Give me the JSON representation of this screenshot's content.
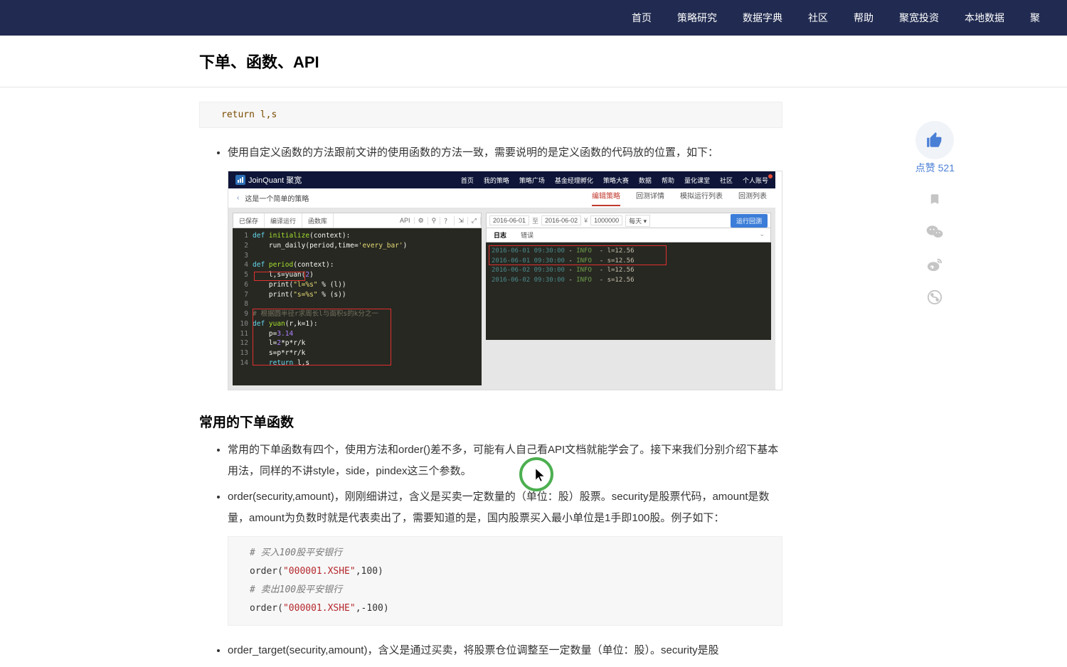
{
  "nav": {
    "items": [
      "首页",
      "策略研究",
      "数据字典",
      "社区",
      "帮助",
      "聚宽投资",
      "本地数据",
      "聚"
    ]
  },
  "header": {
    "title": "下单、函数、API"
  },
  "code_top": {
    "line": "    return l,s"
  },
  "bullet1": "使用自定义函数的方法跟前文讲的使用函数的方法一致，需要说明的是定义函数的代码放的位置，如下：",
  "mini": {
    "logo": "JoinQuant 聚宽",
    "nav": [
      "首页",
      "我的策略",
      "策略广场",
      "基金经理孵化",
      "策略大赛",
      "数据",
      "帮助",
      "量化课堂",
      "社区",
      "个人账号"
    ],
    "back": "‹",
    "strategy_name": "这是一个简单的策略",
    "rtabs": [
      "编辑策略",
      "回测详情",
      "模拟运行列表",
      "回测列表"
    ],
    "toolbar_left": [
      "已保存",
      "编译运行",
      "函数库"
    ],
    "toolbar_right": [
      "API",
      "⚙",
      "⚲",
      "？",
      "⇲",
      "⤢"
    ],
    "editor_lines": [
      {
        "n": "1",
        "prefix": "",
        "kw": "def ",
        "fn": "initialize",
        "rest": "(context):"
      },
      {
        "n": "2",
        "prefix": "    ",
        "text_pre": "run_daily(period,time=",
        "str": "'every_bar'",
        "text_post": ")"
      },
      {
        "n": "3",
        "prefix": "",
        "text_pre": "",
        "text_post": ""
      },
      {
        "n": "4",
        "prefix": "",
        "kw": "def ",
        "fn": "period",
        "rest": "(context):"
      },
      {
        "n": "5",
        "prefix": "    ",
        "text_pre": "l,s=yuan(",
        "num": "2",
        "text_post": ")"
      },
      {
        "n": "6",
        "prefix": "    ",
        "text_pre": "print(",
        "str": "\"l=%s\"",
        "text_post": " % (l))"
      },
      {
        "n": "7",
        "prefix": "    ",
        "text_pre": "print(",
        "str": "\"s=%s\"",
        "text_post": " % (s))"
      },
      {
        "n": "8",
        "prefix": "",
        "text_pre": "",
        "text_post": ""
      },
      {
        "n": "9",
        "prefix": "",
        "com": "# 根据圆半径r求周长l与面积s的k分之一"
      },
      {
        "n": "10",
        "prefix": "",
        "kw": "def ",
        "fn": "yuan",
        "rest": "(r,k=1):"
      },
      {
        "n": "11",
        "prefix": "    ",
        "text_pre": "p=",
        "num": "3.14",
        "text_post": ""
      },
      {
        "n": "12",
        "prefix": "    ",
        "text_pre": "l=",
        "num": "2",
        "text_post": "*p*r/k"
      },
      {
        "n": "13",
        "prefix": "    ",
        "text_pre": "s=p*r*r/k",
        "text_post": ""
      },
      {
        "n": "14",
        "prefix": "    ",
        "kw": "return ",
        "text_pre": "l,s",
        "text_post": ""
      }
    ],
    "run": {
      "date_from": "2016-06-01",
      "to": "至",
      "date_to": "2016-06-02",
      "currency": "¥",
      "amount": "1000000",
      "freq": "每天 ▾",
      "btn": "运行回测"
    },
    "log_tabs": [
      "日志",
      "错误"
    ],
    "logs": [
      {
        "ts": "2016-06-01 09:30:00",
        "lvl": "INFO",
        "msg": "l=12.56"
      },
      {
        "ts": "2016-06-01 09:30:00",
        "lvl": "INFO",
        "msg": "s=12.56"
      },
      {
        "ts": "2016-06-02 09:30:00",
        "lvl": "INFO",
        "msg": "l=12.56"
      },
      {
        "ts": "2016-06-02 09:30:00",
        "lvl": "INFO",
        "msg": "s=12.56"
      }
    ]
  },
  "section2": {
    "title": "常用的下单函数"
  },
  "bullets2": [
    "常用的下单函数有四个，使用方法和order()差不多，可能有人自己看API文档就能学会了。接下来我们分别介绍下基本用法，同样的不讲style，side，pindex这三个参数。",
    "order(security,amount)，刚刚细讲过，含义是买卖一定数量的（单位：股）股票。security是股票代码，amount是数量，amount为负数时就是代表卖出了，需要知道的是，国内股票买入最小单位是1手即100股。例子如下："
  ],
  "code2": {
    "l1_com": "# 买入100股平安银行",
    "l2_fn": "order",
    "l2_str": "\"000001.XSHE\"",
    "l2_rest": ",100)",
    "l3_com": "# 卖出100股平安银行",
    "l4_fn": "order",
    "l4_str": "\"000001.XSHE\"",
    "l4_rest": ",-100)"
  },
  "bullet3": "order_target(security,amount)，含义是通过买卖，将股票仓位调整至一定数量（单位：股）。security是股",
  "sidebar": {
    "like_label": "点赞 521"
  }
}
